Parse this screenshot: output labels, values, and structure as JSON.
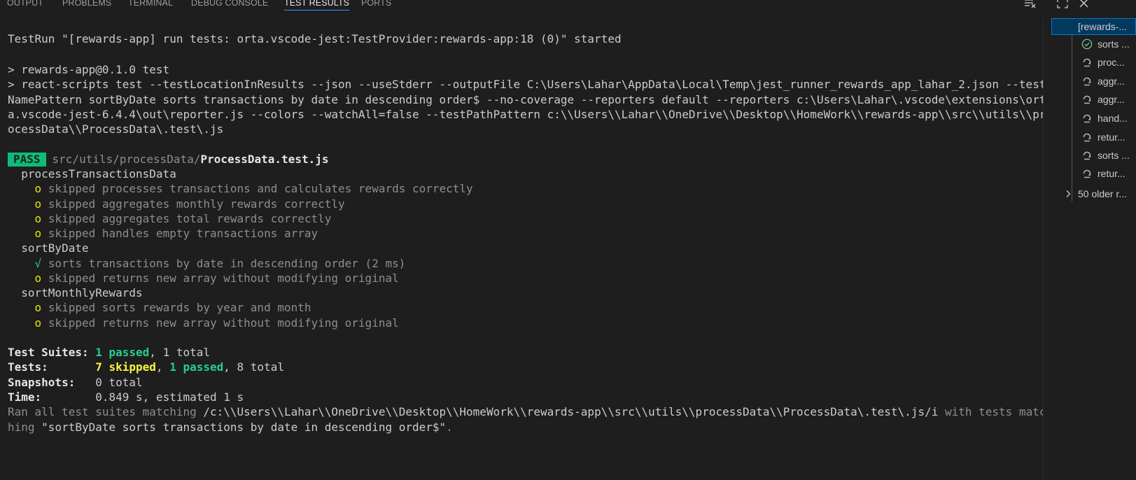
{
  "tabs": [
    {
      "label": "OUTPUT",
      "active": false
    },
    {
      "label": "PROBLEMS",
      "active": false
    },
    {
      "label": "TERMINAL",
      "active": false
    },
    {
      "label": "DEBUG CONSOLE",
      "active": false
    },
    {
      "label": "TEST RESULTS",
      "active": true
    },
    {
      "label": "PORTS",
      "active": false
    }
  ],
  "toolbar_icons": [
    "clear-all-icon",
    "maximize-icon",
    "close-icon"
  ],
  "output": {
    "testrun": "TestRun \"[rewards-app] run tests: orta.vscode-jest:TestProvider:rewards-app:18 (0)\" started",
    "cmd1": "> rewards-app@0.1.0 test",
    "cmd2_l1": "> react-scripts test --testLocationInResults --json --useStderr --outputFile C:\\Users\\Lahar\\AppData\\Local\\Temp\\jest_runner_rewards_app_lahar_2.json --test",
    "cmd2_l2": "NamePattern sortByDate sorts transactions by date in descending order$ --no-coverage --reporters default --reporters c:\\Users\\Lahar\\.vscode\\extensions\\ort",
    "cmd2_l3": "a.vscode-jest-6.4.4\\out\\reporter.js --colors --watchAll=false --testPathPattern c:\\\\Users\\\\Lahar\\\\OneDrive\\\\Desktop\\\\HomeWork\\\\rewards-app\\\\src\\\\utils\\\\pr",
    "cmd2_l4": "ocessData\\\\ProcessData\\.test\\.js",
    "pass_badge": "PASS",
    "pass_dir": "src/utils/processData/",
    "pass_file": "ProcessData.test.js",
    "group1": "processTransactionsData",
    "g1_t1": "skipped processes transactions and calculates rewards correctly",
    "g1_t2": "skipped aggregates monthly rewards correctly",
    "g1_t3": "skipped aggregates total rewards correctly",
    "g1_t4": "skipped handles empty transactions array",
    "group2": "sortByDate",
    "g2_t1": "sorts transactions by date in descending order (2 ms)",
    "g2_t2": "skipped returns new array without modifying original",
    "group3": "sortMonthlyRewards",
    "g3_t1": "skipped sorts rewards by year and month",
    "g3_t2": "skipped returns new array without modifying original",
    "skip_marker": "o",
    "pass_marker": "√",
    "suites_label": "Test Suites:",
    "suites_passed": "1 passed",
    "suites_rest": ", 1 total",
    "tests_label": "Tests:      ",
    "tests_skipped": "7 skipped",
    "tests_sep": ", ",
    "tests_passed": "1 passed",
    "tests_rest": ", 8 total",
    "snap_label": "Snapshots:",
    "snap_value": "   0 total",
    "time_label": "Time:",
    "time_value": "        0.849 s, estimated 1 s",
    "ran_l1_a": "Ran all test suites matching ",
    "ran_l1_b": "/c:\\\\Users\\\\Lahar\\\\OneDrive\\\\Desktop\\\\HomeWork\\\\rewards-app\\\\src\\\\utils\\\\processData\\\\ProcessData\\.test\\.js/i",
    "ran_l1_c": " with tests matc",
    "ran_l2_a": "hing ",
    "ran_l2_b": "\"sortByDate sorts transactions by date in descending order$\"",
    "ran_l2_c": "."
  },
  "sidebar": {
    "root": "[rewards-...",
    "items": [
      {
        "label": "sorts ...",
        "status": "passed",
        "icon": "pass-check-icon"
      },
      {
        "label": "proc...",
        "status": "skipped",
        "icon": "skip-icon"
      },
      {
        "label": "aggr...",
        "status": "skipped",
        "icon": "skip-icon"
      },
      {
        "label": "aggr...",
        "status": "skipped",
        "icon": "skip-icon"
      },
      {
        "label": "hand...",
        "status": "skipped",
        "icon": "skip-icon"
      },
      {
        "label": "retur...",
        "status": "skipped",
        "icon": "skip-icon"
      },
      {
        "label": "sorts ...",
        "status": "skipped",
        "icon": "skip-icon"
      },
      {
        "label": "retur...",
        "status": "skipped",
        "icon": "skip-icon"
      }
    ],
    "older": "50 older r..."
  },
  "colors": {
    "background": "#1e1e1e",
    "pass_green": "#23d18b",
    "skip_yellow": "#f5f543",
    "pass_badge": "#0dbc79",
    "tab_active_underline": "#3794ff",
    "selection": "#04395e"
  }
}
